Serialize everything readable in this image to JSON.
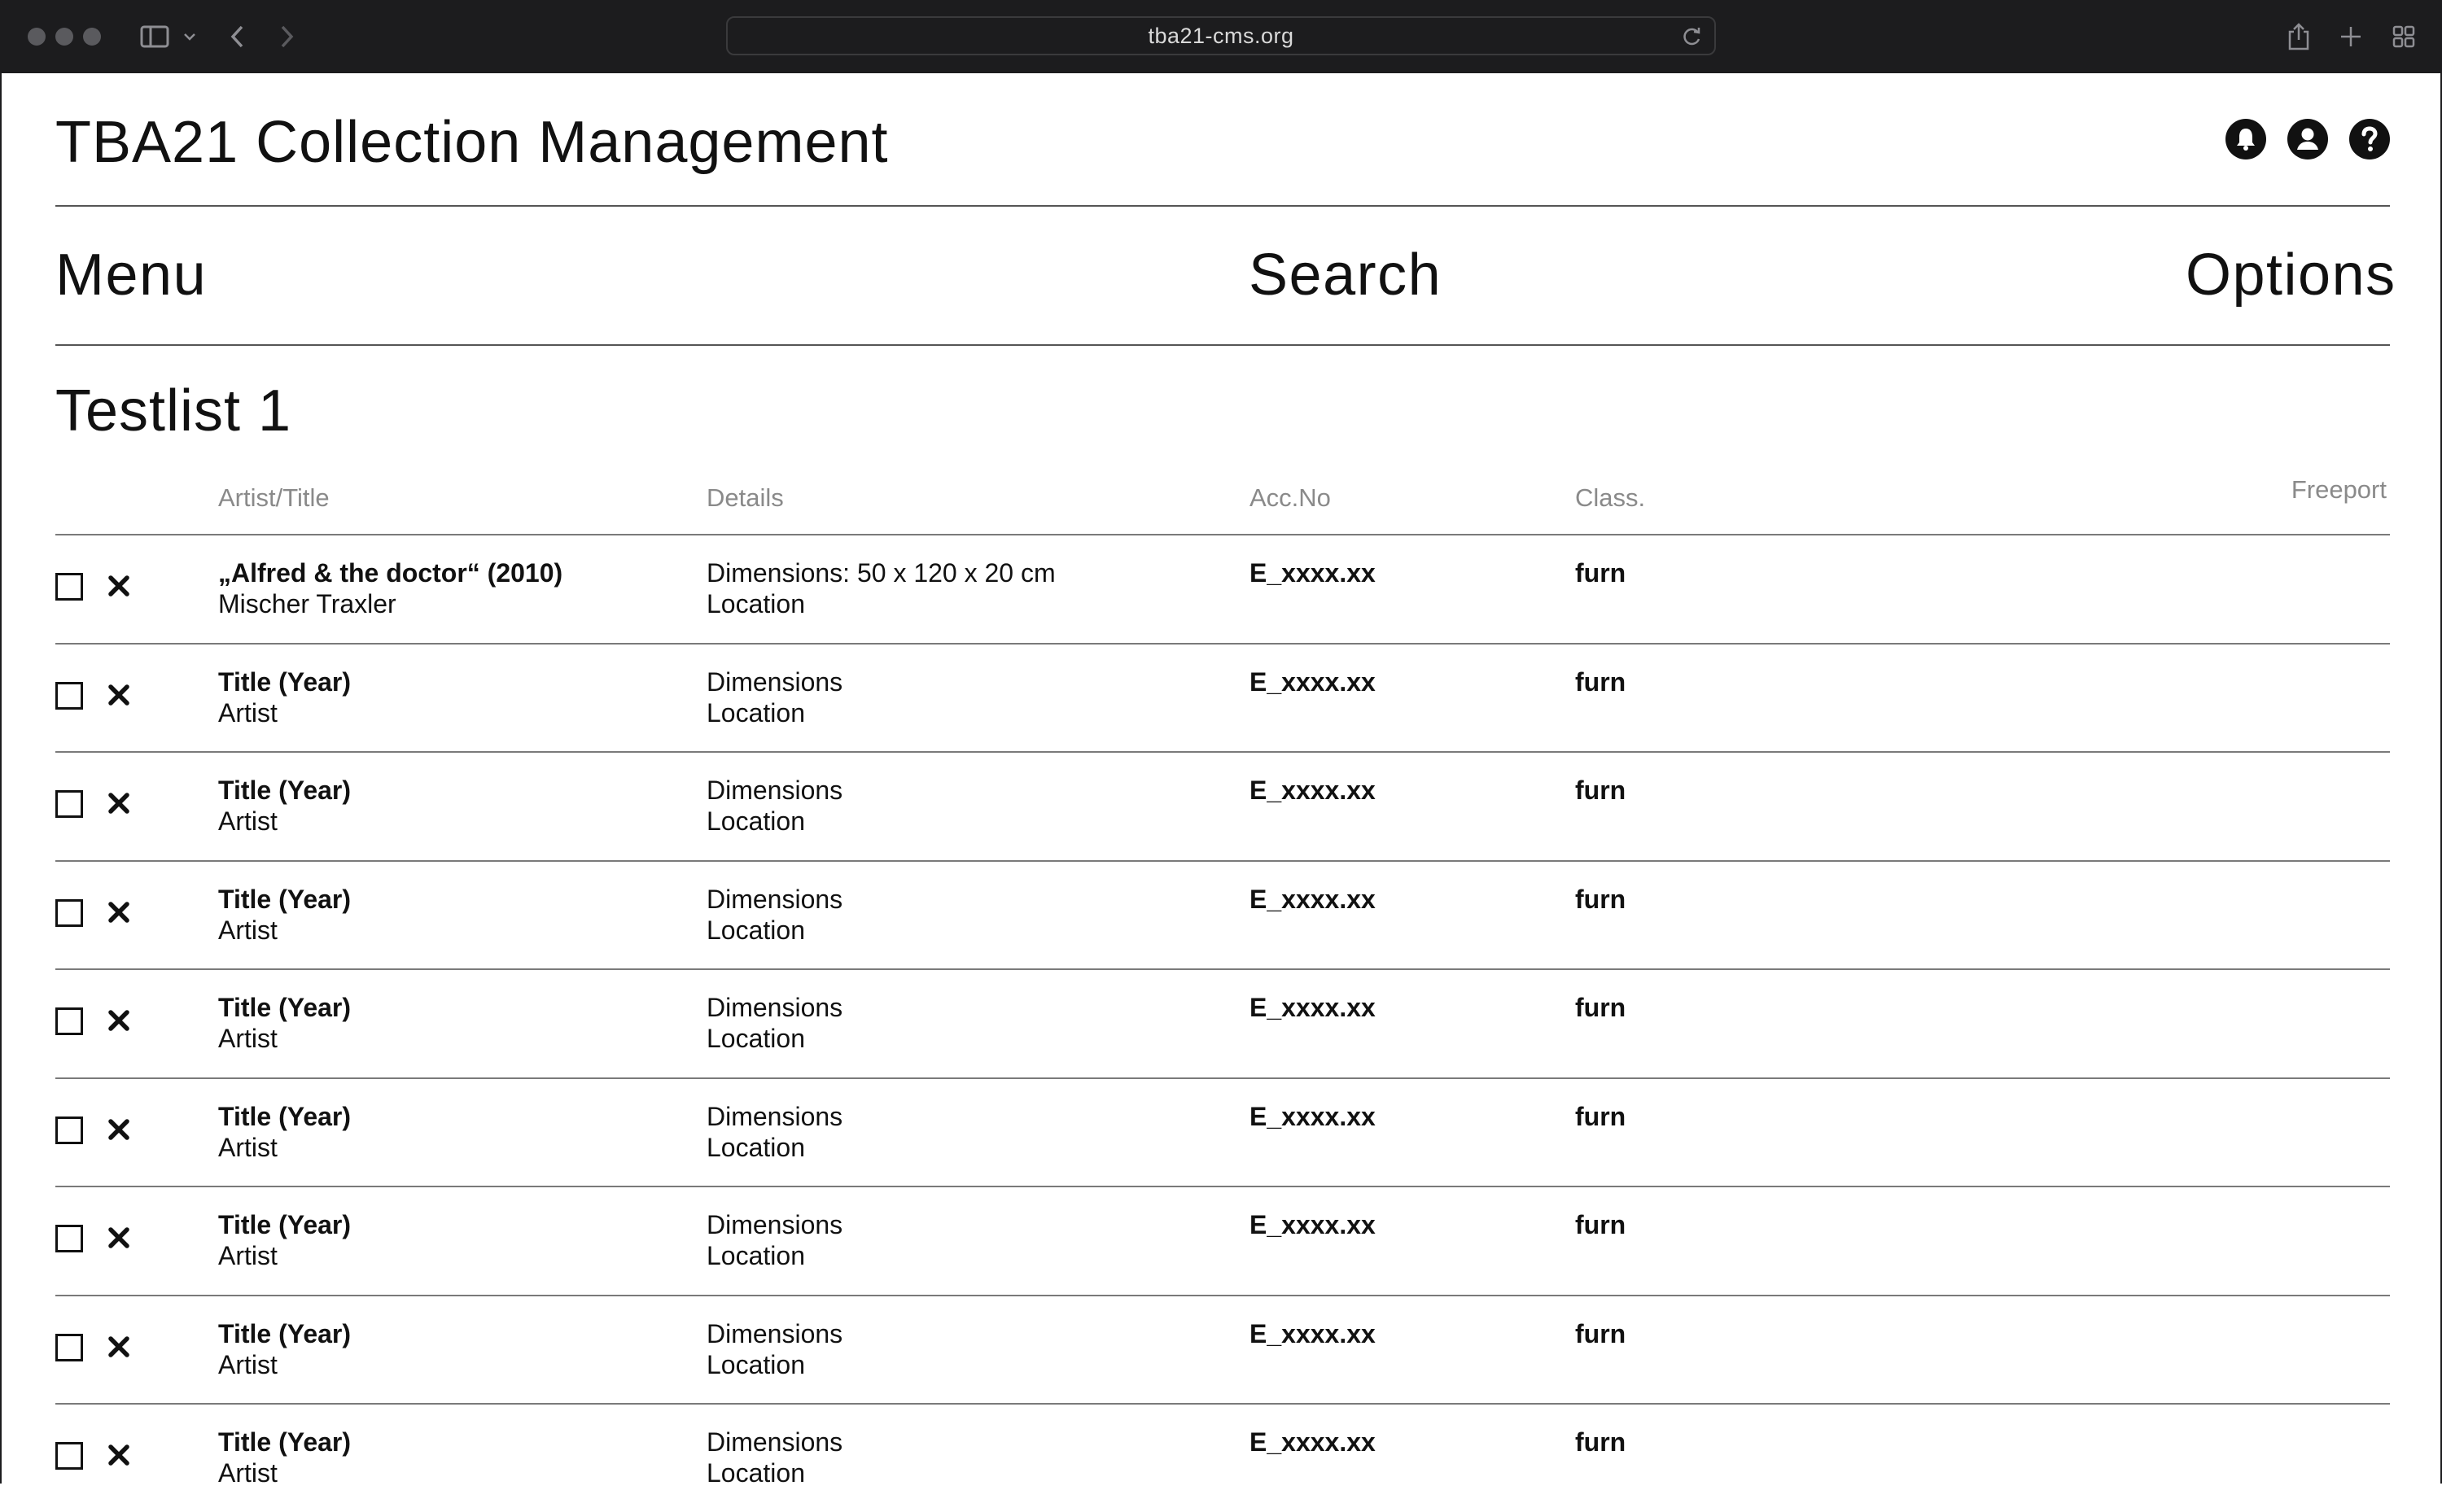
{
  "browser": {
    "url": "tba21-cms.org"
  },
  "header": {
    "title": "TBA21 Collection Management",
    "icons": [
      "bell-icon",
      "account-icon",
      "help-icon"
    ]
  },
  "nav": {
    "menu": "Menu",
    "search": "Search",
    "options": "Options"
  },
  "list": {
    "title": "Testlist 1",
    "columns": {
      "artist_title": "Artist/Title",
      "details": "Details",
      "acc_no": "Acc.No",
      "class": "Class.",
      "freeport": "Freeport"
    },
    "rows": [
      {
        "title": "„Alfred & the doctor“ (2010)",
        "artist": "Mischer Traxler",
        "dimensions": "Dimensions: 50 x 120 x 20 cm",
        "location": "Location",
        "acc_no": "E_xxxx.xx",
        "class": "furn"
      },
      {
        "title": "Title (Year)",
        "artist": "Artist",
        "dimensions": "Dimensions",
        "location": "Location",
        "acc_no": "E_xxxx.xx",
        "class": "furn"
      },
      {
        "title": "Title (Year)",
        "artist": "Artist",
        "dimensions": "Dimensions",
        "location": "Location",
        "acc_no": "E_xxxx.xx",
        "class": "furn"
      },
      {
        "title": "Title (Year)",
        "artist": "Artist",
        "dimensions": "Dimensions",
        "location": "Location",
        "acc_no": "E_xxxx.xx",
        "class": "furn"
      },
      {
        "title": "Title (Year)",
        "artist": "Artist",
        "dimensions": "Dimensions",
        "location": "Location",
        "acc_no": "E_xxxx.xx",
        "class": "furn"
      },
      {
        "title": "Title (Year)",
        "artist": "Artist",
        "dimensions": "Dimensions",
        "location": "Location",
        "acc_no": "E_xxxx.xx",
        "class": "furn"
      },
      {
        "title": "Title (Year)",
        "artist": "Artist",
        "dimensions": "Dimensions",
        "location": "Location",
        "acc_no": "E_xxxx.xx",
        "class": "furn"
      },
      {
        "title": "Title (Year)",
        "artist": "Artist",
        "dimensions": "Dimensions",
        "location": "Location",
        "acc_no": "E_xxxx.xx",
        "class": "furn"
      },
      {
        "title": "Title (Year)",
        "artist": "Artist",
        "dimensions": "Dimensions",
        "location": "Location",
        "acc_no": "E_xxxx.xx",
        "class": "furn"
      }
    ]
  }
}
